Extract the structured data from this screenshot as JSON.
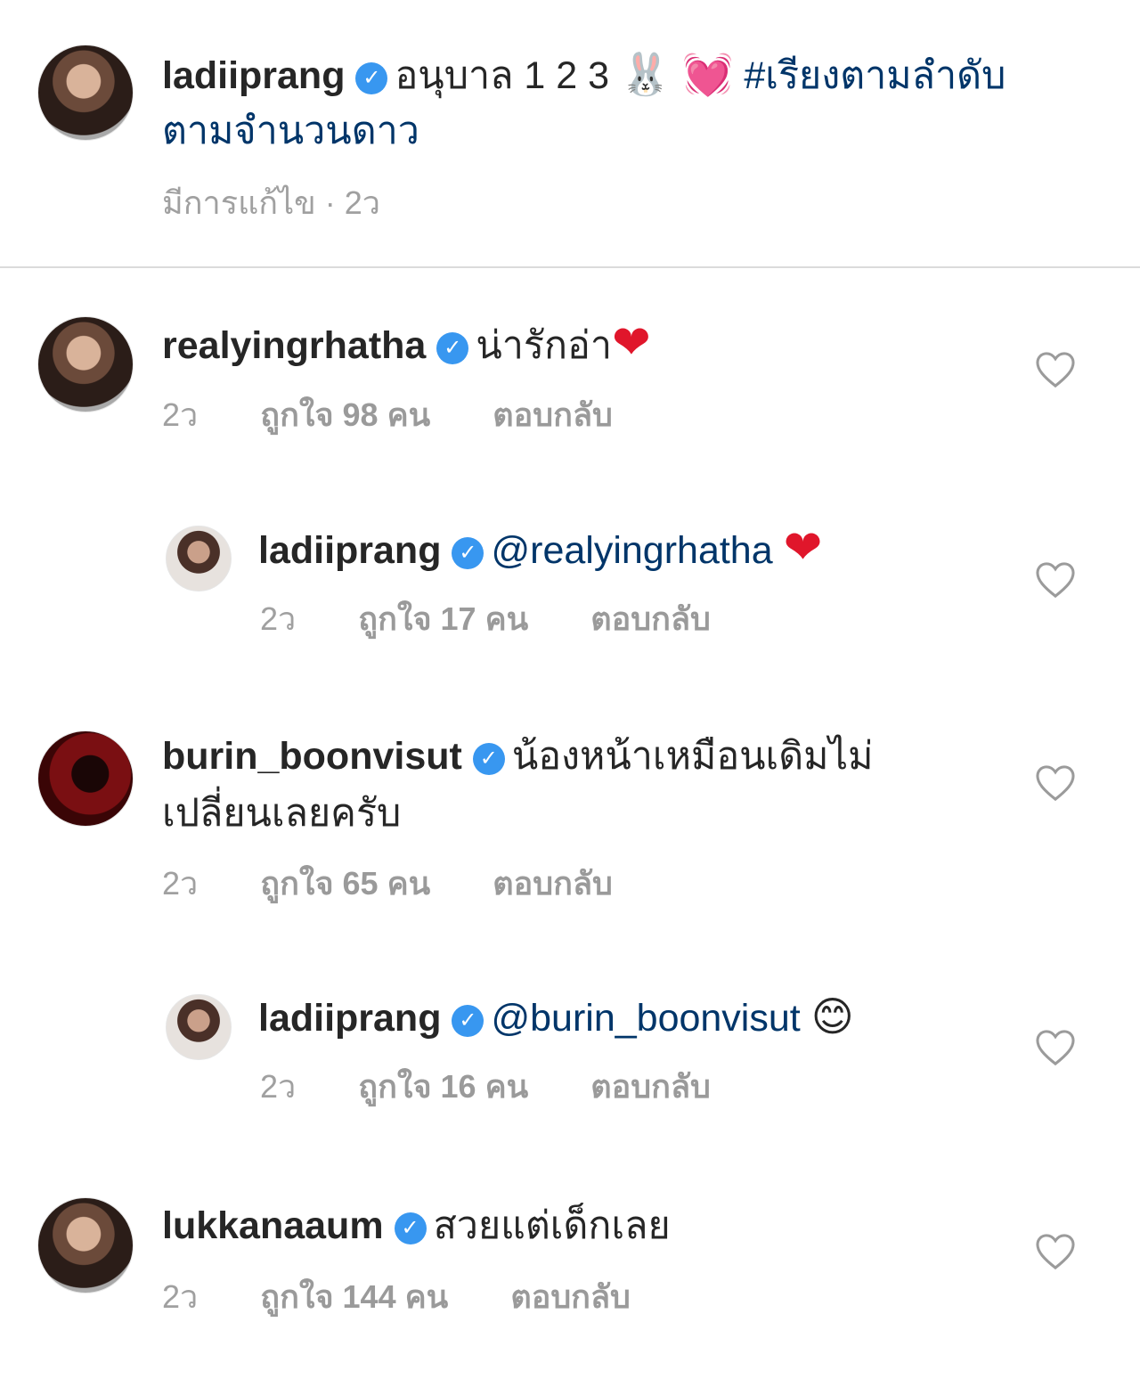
{
  "caption": {
    "username": "ladiiprang",
    "text": "อนุบาล 1 2 3",
    "emojis": "🐰 💓",
    "hashtag_line1": "#เรียงตามลำดับ",
    "hashtag_line2": "ตามจำนวนดาว",
    "meta": "มีการแก้ไข · 2ว"
  },
  "comments": [
    {
      "username": "realyingrhatha",
      "text": "น่ารักอ่า",
      "emoji": "❤",
      "time": "2ว",
      "likes": "ถูกใจ 98 คน",
      "reply": "ตอบกลับ"
    },
    {
      "username": "ladiiprang",
      "mention": "@realyingrhatha",
      "emoji": "❤",
      "time": "2ว",
      "likes": "ถูกใจ 17 คน",
      "reply": "ตอบกลับ"
    },
    {
      "username": "burin_boonvisut",
      "text": "น้องหน้าเหมือนเดิมไม่",
      "text2": "เปลี่ยนเลยครับ",
      "time": "2ว",
      "likes": "ถูกใจ 65 คน",
      "reply": "ตอบกลับ"
    },
    {
      "username": "ladiiprang",
      "mention": "@burin_boonvisut",
      "emoji": "😊",
      "time": "2ว",
      "likes": "ถูกใจ 16 คน",
      "reply": "ตอบกลับ"
    },
    {
      "username": "lukkanaaum",
      "text": "สวยแต่เด็กเลย",
      "time": "2ว",
      "likes": "ถูกใจ 144 คน",
      "reply": "ตอบกลับ"
    }
  ],
  "badge_glyph": "✓",
  "colors": {
    "verified": "#3897f0",
    "hashtag": "#003569",
    "meta": "#a0a0a0"
  }
}
